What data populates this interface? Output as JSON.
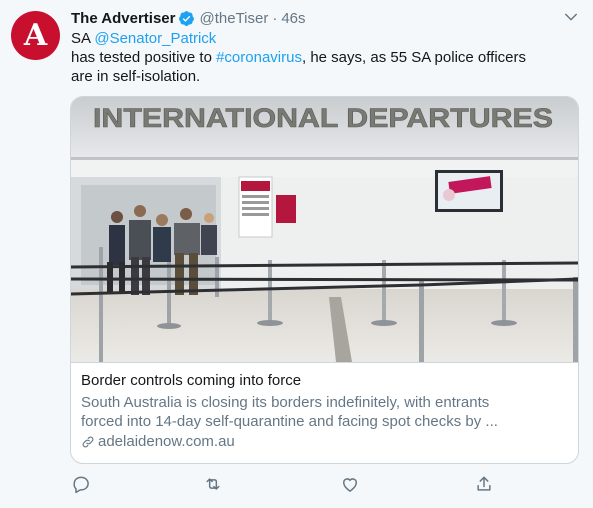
{
  "author": {
    "avatar_letter": "A",
    "display_name": "The Advertiser",
    "handle": "@theTiser",
    "separator": "·",
    "time": "46s"
  },
  "tweet": {
    "prefix": "SA ",
    "mention": "@Senator_Patrick",
    "line2_a": "has tested positive to ",
    "hashtag": "#coronavirus",
    "line2_b": ", he says, as 55 SA police officers",
    "line3": "are in self-isolation."
  },
  "card": {
    "image_sign_text": "INTERNATIONAL  DEPARTURES",
    "title": "Border controls coming into force",
    "description_line1": "South Australia is closing its borders indefinitely, with entrants",
    "description_line2": "forced into 14-day self-quarantine and facing spot checks by ...",
    "domain": "adelaidenow.com.au"
  },
  "icons": {
    "verified": "verified-badge-icon",
    "caret": "chevron-down-icon",
    "reply": "reply-icon",
    "retweet": "retweet-icon",
    "like": "heart-icon",
    "share": "share-icon",
    "link": "link-icon"
  },
  "colors": {
    "link": "#1da1f2",
    "secondary_text": "#657786",
    "avatar_bg": "#c8102e",
    "background": "#f5f8fa"
  }
}
